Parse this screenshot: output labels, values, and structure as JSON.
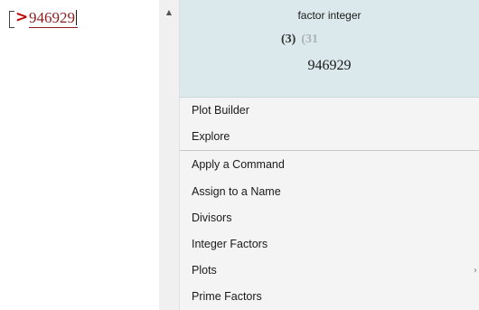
{
  "worksheet": {
    "prompt_symbol": ">",
    "input_value": "946929"
  },
  "scrollbar": {
    "up_icon": "▲"
  },
  "preview": {
    "title": "factor integer",
    "factor_1": "(3)",
    "factor_2": "(31",
    "result": "946929"
  },
  "menu": {
    "items": [
      {
        "label": "Plot Builder"
      },
      {
        "label": "Explore"
      },
      {
        "label": "Apply a Command"
      },
      {
        "label": "Assign to a Name"
      },
      {
        "label": "Divisors"
      },
      {
        "label": "Integer Factors"
      },
      {
        "label": "Plots",
        "submenu_icon": "›"
      },
      {
        "label": "Prime Factors"
      }
    ]
  },
  "colors": {
    "preview_background": "#dce9ec",
    "menu_background": "#f4f4f4",
    "prompt_arrow": "#c00000",
    "input_text": "#8c1f1f"
  }
}
